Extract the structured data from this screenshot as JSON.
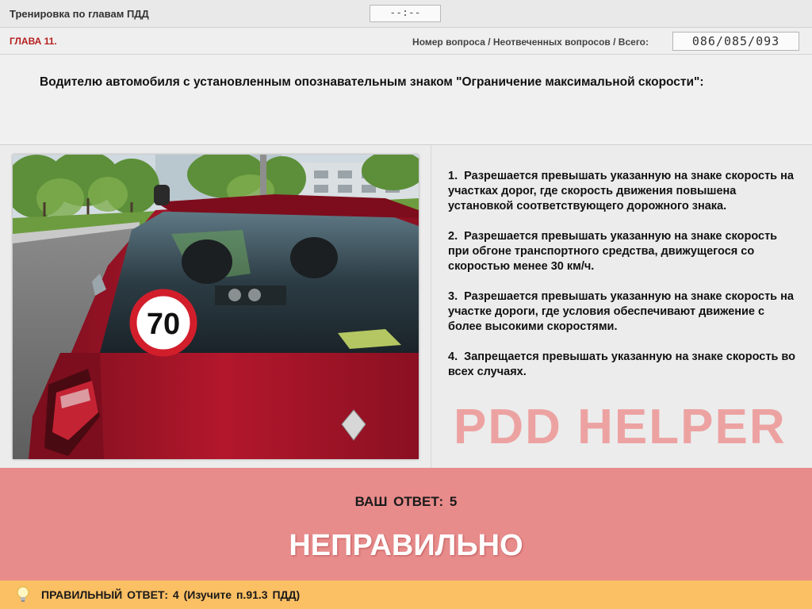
{
  "header": {
    "title": "Тренировка по главам ПДД",
    "timer": "--:--"
  },
  "infobar": {
    "chapter": "ГЛАВА 11.",
    "counter_label": "Номер вопроса / Неотвеченных вопросов / Всего:",
    "counter_value": "086/085/093"
  },
  "question": {
    "text": "Водителю автомобиля с установленным опознавательным знаком \"Ограничение максимальной скорости\":"
  },
  "photo": {
    "sign_value": "70"
  },
  "answers": [
    {
      "num": "1.",
      "text": "Разрешается превышать указанную на знаке скорость на участках дорог, где скорость движения повышена установкой соответствующего дорожного знака."
    },
    {
      "num": "2.",
      "text": "Разрешается превышать указанную на знаке скорость при обгоне транспортного средства, движущегося со скоростью менее 30 км/ч."
    },
    {
      "num": "3.",
      "text": "Разрешается превышать указанную на знаке скорость на участке дороги, где условия обеспечивают движение с более высокими скоростями."
    },
    {
      "num": "4.",
      "text": "Запрещается превышать указанную на знаке скорость во всех случаях."
    }
  ],
  "watermark": "PDD HELPER",
  "result": {
    "your_answer": "ВАШ ОТВЕТ: 5",
    "verdict": "НЕПРАВИЛЬНО"
  },
  "correct": {
    "text": "ПРАВИЛЬНЫЙ ОТВЕТ: 4 (Изучите п.91.3 ПДД)",
    "icon": "lightbulb-icon"
  },
  "colors": {
    "result_bg": "#e88b8b",
    "correct_bg": "#fbbf64",
    "chapter": "#b51f1f"
  }
}
